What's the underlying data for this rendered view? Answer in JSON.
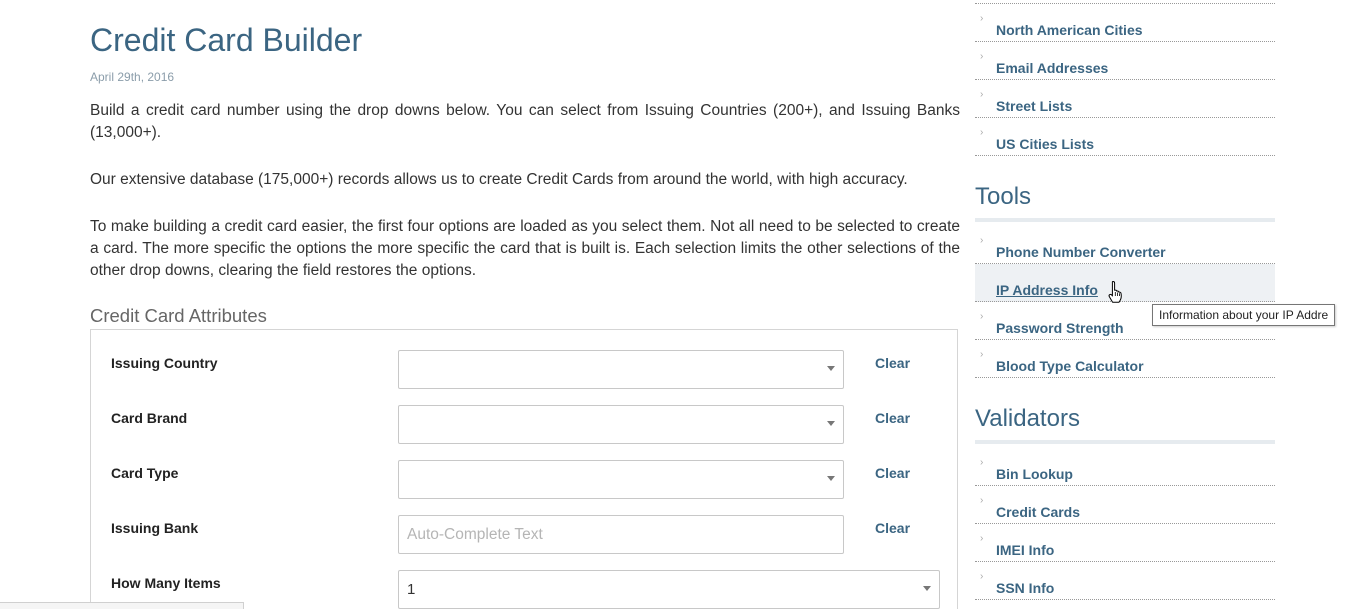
{
  "article": {
    "title": "Credit Card Builder",
    "date": "April 29th, 2016",
    "paragraphs": [
      "Build a credit card number using the drop downs below. You can select from Issuing Countries (200+), and Issuing Banks (13,000+).",
      "Our extensive database (175,000+) records allows us to create Credit Cards from around the world, with high accuracy.",
      "To make building a credit card easier, the first four options are loaded as you select them. Not all need to be selected to create a card. The more specific the options the more specific the card that is built is. Each selection limits the other selections of the other drop downs, clearing the field restores the options."
    ]
  },
  "attributes": {
    "title": "Credit Card Attributes",
    "clear_label": "Clear",
    "issuing_country": {
      "label": "Issuing Country",
      "value": ""
    },
    "card_brand": {
      "label": "Card Brand",
      "value": ""
    },
    "card_type": {
      "label": "Card Type",
      "value": ""
    },
    "issuing_bank": {
      "label": "Issuing Bank",
      "placeholder": "Auto-Complete Text"
    },
    "how_many": {
      "label": "How Many Items",
      "value": "1"
    }
  },
  "sidebar": {
    "data_links": [
      "North American Cities",
      "Email Addresses",
      "Street Lists",
      "US Cities Lists"
    ],
    "tools_heading": "Tools",
    "tools_links": [
      "Phone Number Converter",
      "IP Address Info",
      "Password Strength",
      "Blood Type Calculator"
    ],
    "validators_heading": "Validators",
    "validators_links": [
      "Bin Lookup",
      "Credit Cards",
      "IMEI Info",
      "SSN Info"
    ]
  },
  "tooltip": {
    "text": "Information about your IP Addre"
  },
  "icons": {
    "list_bullet": "chevron-right-icon",
    "dropdown": "chevron-down-icon",
    "cursor": "hand-pointer-icon"
  },
  "colors": {
    "accent": "#3b6582",
    "text": "#333333",
    "muted": "#8b9daa"
  }
}
